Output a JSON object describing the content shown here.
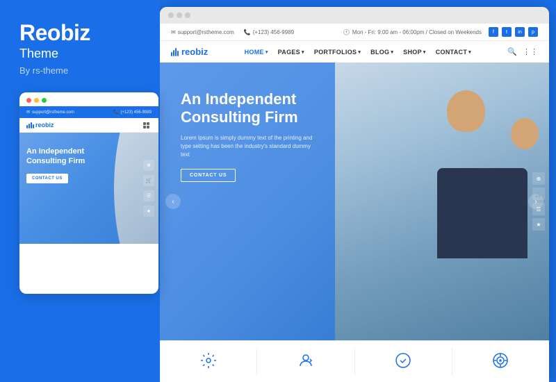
{
  "left": {
    "title": "Reobiz",
    "subtitle": "Theme",
    "by": "By rs-theme",
    "mobile": {
      "email": "support@rstheme.com",
      "phone": "(+123) 456-9989",
      "logo": "reobiz",
      "hero_title": "An Independent Consulting Firm",
      "contact_btn": "CONTACT US"
    }
  },
  "site": {
    "topbar": {
      "email": "support@rstheme.com",
      "phone": "(+123) 456-9989",
      "hours": "Mon - Fri: 9:00 am - 06:00pm / Closed on Weekends"
    },
    "nav": {
      "logo": "reobiz",
      "links": [
        "HOME",
        "PAGES",
        "PORTFOLIOS",
        "BLOG",
        "SHOP",
        "CONTACT"
      ]
    },
    "hero": {
      "title": "An Independent Consulting Firm",
      "description": "Lorem Ipsum is simply dummy text of the printing and type setting has been the industry's standard dummy text",
      "contact_btn": "CONTACT US"
    },
    "features": [
      {
        "icon": "⚙",
        "label": ""
      },
      {
        "icon": "👤",
        "label": ""
      },
      {
        "icon": "✓",
        "label": ""
      },
      {
        "icon": "◎",
        "label": ""
      }
    ]
  },
  "colors": {
    "brand_blue": "#1a6fe8",
    "white": "#ffffff",
    "text_dark": "#333333"
  }
}
